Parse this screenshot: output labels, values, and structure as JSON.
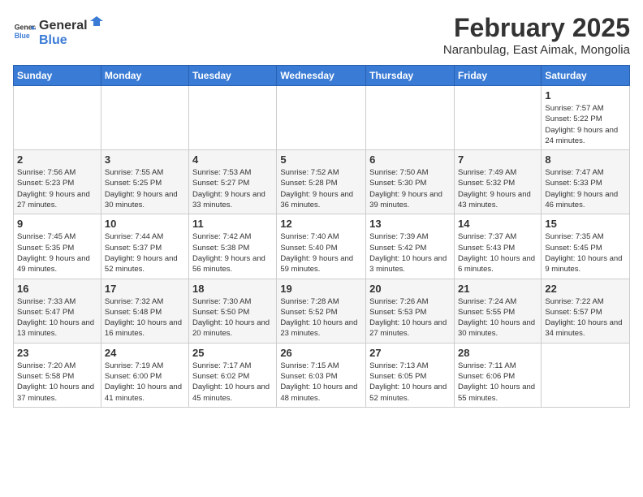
{
  "header": {
    "logo_general": "General",
    "logo_blue": "Blue",
    "month_title": "February 2025",
    "location": "Naranbulag, East Aimak, Mongolia"
  },
  "weekdays": [
    "Sunday",
    "Monday",
    "Tuesday",
    "Wednesday",
    "Thursday",
    "Friday",
    "Saturday"
  ],
  "weeks": [
    [
      {
        "day": "",
        "info": ""
      },
      {
        "day": "",
        "info": ""
      },
      {
        "day": "",
        "info": ""
      },
      {
        "day": "",
        "info": ""
      },
      {
        "day": "",
        "info": ""
      },
      {
        "day": "",
        "info": ""
      },
      {
        "day": "1",
        "info": "Sunrise: 7:57 AM\nSunset: 5:22 PM\nDaylight: 9 hours and 24 minutes."
      }
    ],
    [
      {
        "day": "2",
        "info": "Sunrise: 7:56 AM\nSunset: 5:23 PM\nDaylight: 9 hours and 27 minutes."
      },
      {
        "day": "3",
        "info": "Sunrise: 7:55 AM\nSunset: 5:25 PM\nDaylight: 9 hours and 30 minutes."
      },
      {
        "day": "4",
        "info": "Sunrise: 7:53 AM\nSunset: 5:27 PM\nDaylight: 9 hours and 33 minutes."
      },
      {
        "day": "5",
        "info": "Sunrise: 7:52 AM\nSunset: 5:28 PM\nDaylight: 9 hours and 36 minutes."
      },
      {
        "day": "6",
        "info": "Sunrise: 7:50 AM\nSunset: 5:30 PM\nDaylight: 9 hours and 39 minutes."
      },
      {
        "day": "7",
        "info": "Sunrise: 7:49 AM\nSunset: 5:32 PM\nDaylight: 9 hours and 43 minutes."
      },
      {
        "day": "8",
        "info": "Sunrise: 7:47 AM\nSunset: 5:33 PM\nDaylight: 9 hours and 46 minutes."
      }
    ],
    [
      {
        "day": "9",
        "info": "Sunrise: 7:45 AM\nSunset: 5:35 PM\nDaylight: 9 hours and 49 minutes."
      },
      {
        "day": "10",
        "info": "Sunrise: 7:44 AM\nSunset: 5:37 PM\nDaylight: 9 hours and 52 minutes."
      },
      {
        "day": "11",
        "info": "Sunrise: 7:42 AM\nSunset: 5:38 PM\nDaylight: 9 hours and 56 minutes."
      },
      {
        "day": "12",
        "info": "Sunrise: 7:40 AM\nSunset: 5:40 PM\nDaylight: 9 hours and 59 minutes."
      },
      {
        "day": "13",
        "info": "Sunrise: 7:39 AM\nSunset: 5:42 PM\nDaylight: 10 hours and 3 minutes."
      },
      {
        "day": "14",
        "info": "Sunrise: 7:37 AM\nSunset: 5:43 PM\nDaylight: 10 hours and 6 minutes."
      },
      {
        "day": "15",
        "info": "Sunrise: 7:35 AM\nSunset: 5:45 PM\nDaylight: 10 hours and 9 minutes."
      }
    ],
    [
      {
        "day": "16",
        "info": "Sunrise: 7:33 AM\nSunset: 5:47 PM\nDaylight: 10 hours and 13 minutes."
      },
      {
        "day": "17",
        "info": "Sunrise: 7:32 AM\nSunset: 5:48 PM\nDaylight: 10 hours and 16 minutes."
      },
      {
        "day": "18",
        "info": "Sunrise: 7:30 AM\nSunset: 5:50 PM\nDaylight: 10 hours and 20 minutes."
      },
      {
        "day": "19",
        "info": "Sunrise: 7:28 AM\nSunset: 5:52 PM\nDaylight: 10 hours and 23 minutes."
      },
      {
        "day": "20",
        "info": "Sunrise: 7:26 AM\nSunset: 5:53 PM\nDaylight: 10 hours and 27 minutes."
      },
      {
        "day": "21",
        "info": "Sunrise: 7:24 AM\nSunset: 5:55 PM\nDaylight: 10 hours and 30 minutes."
      },
      {
        "day": "22",
        "info": "Sunrise: 7:22 AM\nSunset: 5:57 PM\nDaylight: 10 hours and 34 minutes."
      }
    ],
    [
      {
        "day": "23",
        "info": "Sunrise: 7:20 AM\nSunset: 5:58 PM\nDaylight: 10 hours and 37 minutes."
      },
      {
        "day": "24",
        "info": "Sunrise: 7:19 AM\nSunset: 6:00 PM\nDaylight: 10 hours and 41 minutes."
      },
      {
        "day": "25",
        "info": "Sunrise: 7:17 AM\nSunset: 6:02 PM\nDaylight: 10 hours and 45 minutes."
      },
      {
        "day": "26",
        "info": "Sunrise: 7:15 AM\nSunset: 6:03 PM\nDaylight: 10 hours and 48 minutes."
      },
      {
        "day": "27",
        "info": "Sunrise: 7:13 AM\nSunset: 6:05 PM\nDaylight: 10 hours and 52 minutes."
      },
      {
        "day": "28",
        "info": "Sunrise: 7:11 AM\nSunset: 6:06 PM\nDaylight: 10 hours and 55 minutes."
      },
      {
        "day": "",
        "info": ""
      }
    ]
  ]
}
